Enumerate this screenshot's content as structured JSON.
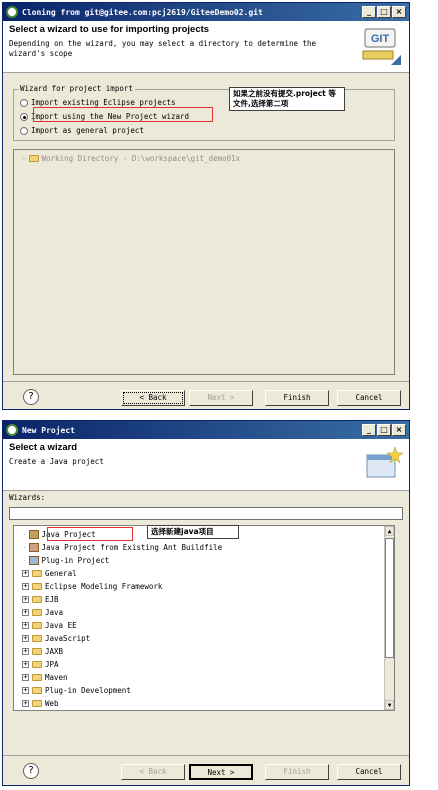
{
  "window1": {
    "title": "Cloning from git@gitee.com:pcj2619/GiteeDemo02.git",
    "header_title": "Select a wizard to use for importing projects",
    "header_desc": "Depending on the wizard, you may select a directory to determine the wizard's scope",
    "group_label": "Wizard for project import",
    "options": [
      "Import existing Eclipse projects",
      "Import using the New Project wizard",
      "Import as general project"
    ],
    "selected_option": 1,
    "callout": "如果之前没有提交.project 等文件,选择第二项",
    "working_dir": "Working Directory - D:\\workspace\\git_demo01x",
    "buttons": {
      "back": "< Back",
      "next": "Next >",
      "finish": "Finish",
      "cancel": "Cancel"
    }
  },
  "window2": {
    "title": "New Project",
    "header_title": "Select a wizard",
    "header_desc": "Create a Java project",
    "wizards_label": "Wizards:",
    "filter_value": "",
    "callout": "选择新建java项目",
    "items": [
      {
        "label": "Java Project",
        "icon": "java-project-icon",
        "expandable": false
      },
      {
        "label": "Java Project from Existing Ant Buildfile",
        "icon": "ant-icon",
        "expandable": false
      },
      {
        "label": "Plug-in Project",
        "icon": "plugin-icon",
        "expandable": false
      },
      {
        "label": "General",
        "icon": "folder-icon",
        "expandable": true
      },
      {
        "label": "Eclipse Modeling Framework",
        "icon": "folder-icon",
        "expandable": true
      },
      {
        "label": "EJB",
        "icon": "folder-icon",
        "expandable": true
      },
      {
        "label": "Java",
        "icon": "folder-icon",
        "expandable": true
      },
      {
        "label": "Java EE",
        "icon": "folder-icon",
        "expandable": true
      },
      {
        "label": "JavaScript",
        "icon": "folder-icon",
        "expandable": true
      },
      {
        "label": "JAXB",
        "icon": "folder-icon",
        "expandable": true
      },
      {
        "label": "JPA",
        "icon": "folder-icon",
        "expandable": true
      },
      {
        "label": "Maven",
        "icon": "folder-icon",
        "expandable": true
      },
      {
        "label": "Plug-in Development",
        "icon": "folder-icon",
        "expandable": true
      },
      {
        "label": "Web",
        "icon": "folder-icon",
        "expandable": true
      }
    ],
    "buttons": {
      "back": "< Back",
      "next": "Next >",
      "finish": "Finish",
      "cancel": "Cancel"
    }
  },
  "window_controls": {
    "minimize": "_",
    "maximize": "□",
    "close": "×"
  },
  "help": "?",
  "git_logo_text": "GIT"
}
